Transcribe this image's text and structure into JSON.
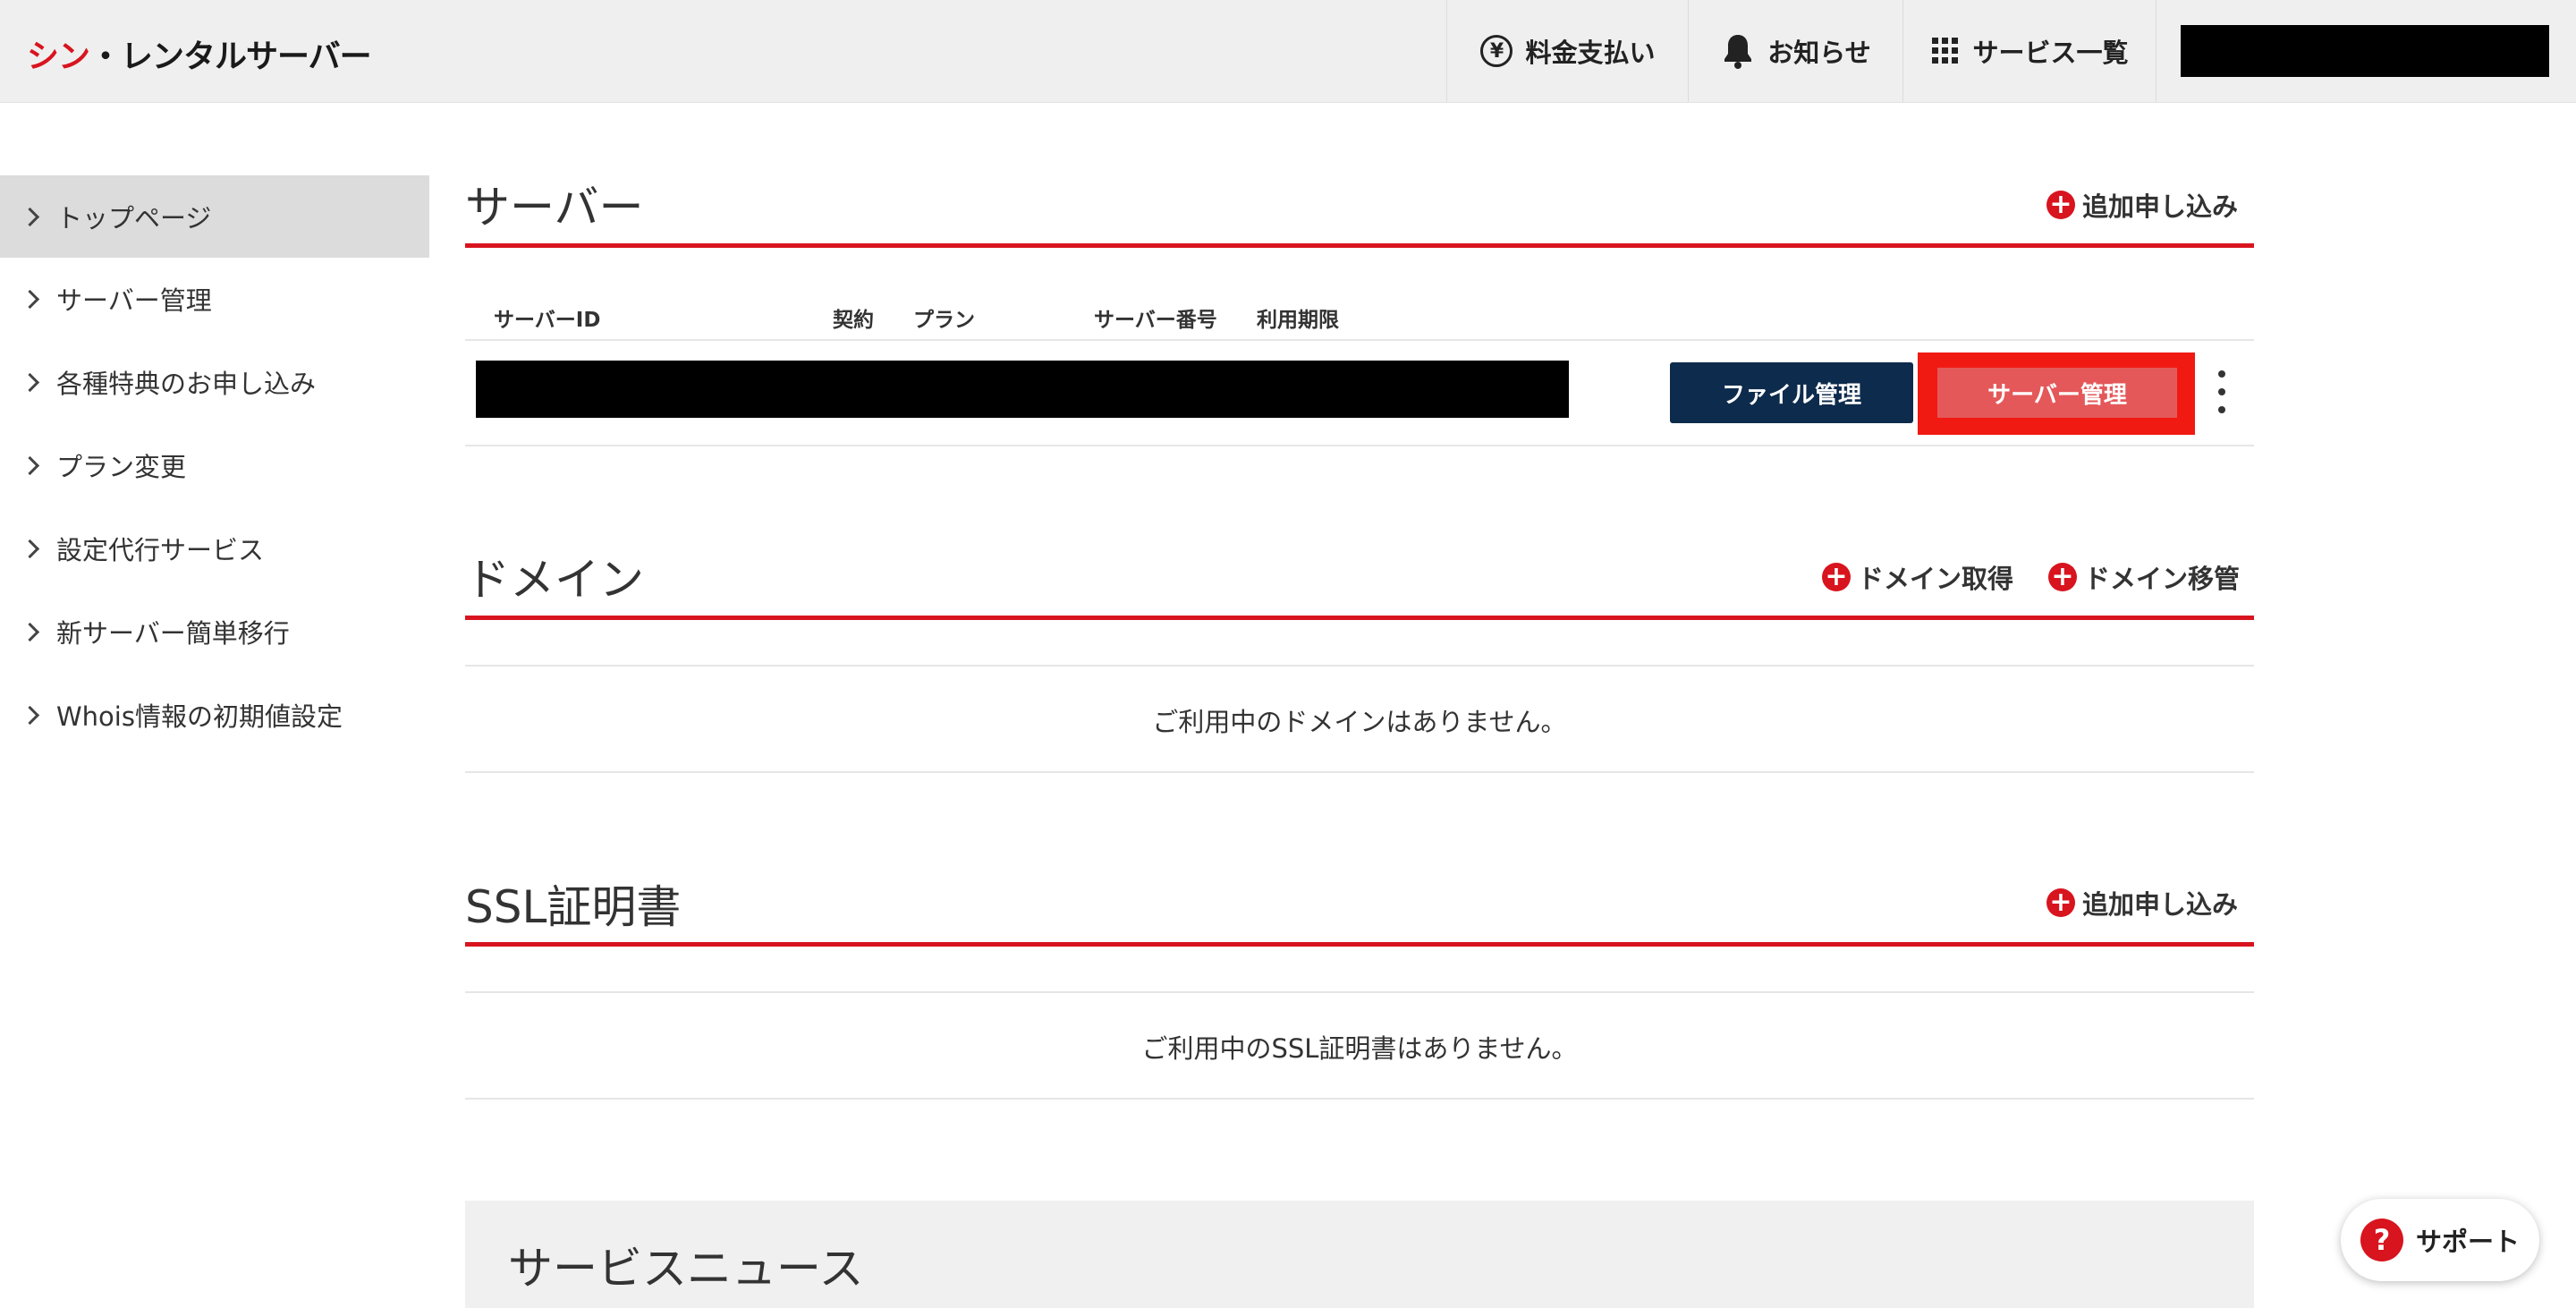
{
  "header": {
    "logo_red": "シン",
    "logo_rest": "・レンタルサーバー",
    "nav": {
      "billing": "料金支払い",
      "notices": "お知らせ",
      "services": "サービス一覧"
    }
  },
  "sidebar": {
    "items": [
      {
        "label": "トップページ",
        "active": true
      },
      {
        "label": "サーバー管理"
      },
      {
        "label": "各種特典のお申し込み"
      },
      {
        "label": "プラン変更"
      },
      {
        "label": "設定代行サービス"
      },
      {
        "label": "新サーバー簡単移行"
      },
      {
        "label": "Whois情報の初期値設定"
      }
    ]
  },
  "server": {
    "title": "サーバー",
    "add_label": "追加申し込み",
    "columns": [
      "サーバーID",
      "契約",
      "プラン",
      "サーバー番号",
      "利用期限"
    ],
    "file_button": "ファイル管理",
    "manage_button": "サーバー管理"
  },
  "domain": {
    "title": "ドメイン",
    "acquire_label": "ドメイン取得",
    "transfer_label": "ドメイン移管",
    "empty_message": "ご利用中のドメインはありません。"
  },
  "ssl": {
    "title": "SSL証明書",
    "add_label": "追加申し込み",
    "empty_message": "ご利用中のSSL証明書はありません。"
  },
  "news": {
    "title": "サービスニュース"
  },
  "support": {
    "label": "サポート"
  },
  "colors": {
    "brand_red": "#d8141e",
    "navy_button": "#0d2b4c",
    "highlight": "#f01a12"
  }
}
